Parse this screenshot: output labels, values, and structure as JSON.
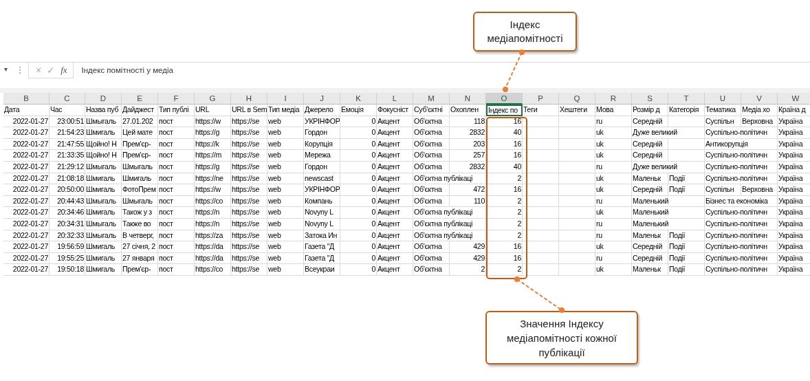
{
  "formula_bar": {
    "name_box_caret": "▾",
    "cancel": "×",
    "enter": "✓",
    "function": "fx",
    "formula": "Індекс помітності у медіа"
  },
  "columns": [
    {
      "letter": "B",
      "selected": false
    },
    {
      "letter": "C",
      "selected": false
    },
    {
      "letter": "D",
      "selected": false
    },
    {
      "letter": "E",
      "selected": false
    },
    {
      "letter": "F",
      "selected": false
    },
    {
      "letter": "G",
      "selected": false
    },
    {
      "letter": "H",
      "selected": false
    },
    {
      "letter": "I",
      "selected": false
    },
    {
      "letter": "J",
      "selected": false
    },
    {
      "letter": "K",
      "selected": false
    },
    {
      "letter": "L",
      "selected": false
    },
    {
      "letter": "M",
      "selected": false
    },
    {
      "letter": "N",
      "selected": false
    },
    {
      "letter": "O",
      "selected": true
    },
    {
      "letter": "P",
      "selected": false
    },
    {
      "letter": "Q",
      "selected": false
    },
    {
      "letter": "R",
      "selected": false
    },
    {
      "letter": "S",
      "selected": false
    },
    {
      "letter": "T",
      "selected": false
    },
    {
      "letter": "U",
      "selected": false
    },
    {
      "letter": "V",
      "selected": false
    },
    {
      "letter": "W",
      "selected": false
    }
  ],
  "header_row": [
    "Дата",
    "Час",
    "Назва пуб",
    "Дайджест",
    "Тип публі",
    "URL",
    "URL в Sem",
    "Тип медіа",
    "Джерело",
    "Емоція",
    "Фокусніст",
    "Суб'єктні",
    "Охоплен",
    "Індекс по",
    "Теги",
    "Хештеги",
    "Мова",
    "Розмір д",
    "Категорія",
    "Тематика",
    "Медіа хо",
    "Країна д"
  ],
  "rows": [
    {
      "cells": [
        {
          "kind": "number",
          "text": "2022-01-27"
        },
        {
          "kind": "number",
          "text": "23:00:51"
        },
        {
          "kind": "text",
          "text": "Шмыгаль"
        },
        {
          "kind": "text",
          "text": "27.01.202"
        },
        {
          "kind": "text",
          "text": "пост"
        },
        {
          "kind": "text",
          "text": "https://w"
        },
        {
          "kind": "text",
          "text": "https://se"
        },
        {
          "kind": "text",
          "text": "web"
        },
        {
          "kind": "text",
          "text": "УКРІНФОР"
        },
        {
          "kind": "number",
          "text": "0"
        },
        {
          "kind": "text",
          "text": "Акцент"
        },
        {
          "kind": "text",
          "text": "Об'єктна"
        },
        {
          "kind": "number",
          "text": "118"
        },
        {
          "kind": "number",
          "text": "16"
        },
        {
          "kind": "blank"
        },
        {
          "kind": "blank"
        },
        {
          "kind": "text",
          "text": "ru"
        },
        {
          "kind": "text",
          "text": "Середній"
        },
        {
          "kind": "blank"
        },
        {
          "kind": "text",
          "text": "Суспільн"
        },
        {
          "kind": "text",
          "text": "Верховна"
        },
        {
          "kind": "text",
          "text": "Україна"
        }
      ]
    },
    {
      "cells": [
        {
          "kind": "number",
          "text": "2022-01-27"
        },
        {
          "kind": "number",
          "text": "21:54:23"
        },
        {
          "kind": "text",
          "text": "Шмигаль"
        },
        {
          "kind": "text",
          "text": "Цей мате"
        },
        {
          "kind": "text",
          "text": "пост"
        },
        {
          "kind": "text",
          "text": "https://g"
        },
        {
          "kind": "text",
          "text": "https://se"
        },
        {
          "kind": "text",
          "text": "web"
        },
        {
          "kind": "text",
          "text": "Гордон"
        },
        {
          "kind": "number",
          "text": "0"
        },
        {
          "kind": "text",
          "text": "Акцент"
        },
        {
          "kind": "text",
          "text": "Об'єктна"
        },
        {
          "kind": "number",
          "text": "2832"
        },
        {
          "kind": "number",
          "text": "40"
        },
        {
          "kind": "blank"
        },
        {
          "kind": "blank"
        },
        {
          "kind": "text",
          "text": "uk"
        },
        {
          "kind": "text",
          "text": "Дуже великий"
        },
        {
          "kind": "blank"
        },
        {
          "kind": "text",
          "text": "Суспільно-політичн"
        },
        {
          "kind": "blank"
        },
        {
          "kind": "text",
          "text": "Україна"
        }
      ]
    },
    {
      "cells": [
        {
          "kind": "number",
          "text": "2022-01-27"
        },
        {
          "kind": "number",
          "text": "21:47:55"
        },
        {
          "kind": "text",
          "text": "Щойно! Н"
        },
        {
          "kind": "text",
          "text": "Прем'єр-"
        },
        {
          "kind": "text",
          "text": "пост"
        },
        {
          "kind": "text",
          "text": "https://k"
        },
        {
          "kind": "text",
          "text": "https://se"
        },
        {
          "kind": "text",
          "text": "web"
        },
        {
          "kind": "text",
          "text": "Корупція"
        },
        {
          "kind": "number",
          "text": "0"
        },
        {
          "kind": "text",
          "text": "Акцент"
        },
        {
          "kind": "text",
          "text": "Об'єктна"
        },
        {
          "kind": "number",
          "text": "203"
        },
        {
          "kind": "number",
          "text": "16"
        },
        {
          "kind": "blank"
        },
        {
          "kind": "blank"
        },
        {
          "kind": "text",
          "text": "uk"
        },
        {
          "kind": "text",
          "text": "Середній"
        },
        {
          "kind": "blank"
        },
        {
          "kind": "text",
          "text": "Антикорупція"
        },
        {
          "kind": "blank"
        },
        {
          "kind": "text",
          "text": "Україна"
        }
      ]
    },
    {
      "cells": [
        {
          "kind": "number",
          "text": "2022-01-27"
        },
        {
          "kind": "number",
          "text": "21:33:35"
        },
        {
          "kind": "text",
          "text": "Щойно! Н"
        },
        {
          "kind": "text",
          "text": "Прем'єр-"
        },
        {
          "kind": "text",
          "text": "пост"
        },
        {
          "kind": "text",
          "text": "https://m"
        },
        {
          "kind": "text",
          "text": "https://se"
        },
        {
          "kind": "text",
          "text": "web"
        },
        {
          "kind": "text",
          "text": "Мережа"
        },
        {
          "kind": "number",
          "text": "0"
        },
        {
          "kind": "text",
          "text": "Акцент"
        },
        {
          "kind": "text",
          "text": "Об'єктна"
        },
        {
          "kind": "number",
          "text": "257"
        },
        {
          "kind": "number",
          "text": "16"
        },
        {
          "kind": "blank"
        },
        {
          "kind": "blank"
        },
        {
          "kind": "text",
          "text": "uk"
        },
        {
          "kind": "text",
          "text": "Середній"
        },
        {
          "kind": "blank"
        },
        {
          "kind": "text",
          "text": "Суспільно-політичн"
        },
        {
          "kind": "blank"
        },
        {
          "kind": "text",
          "text": "Україна"
        }
      ]
    },
    {
      "cells": [
        {
          "kind": "number",
          "text": "2022-01-27"
        },
        {
          "kind": "number",
          "text": "21:29:12"
        },
        {
          "kind": "text",
          "text": "Шмыгаль"
        },
        {
          "kind": "text",
          "text": "Шмыгаль"
        },
        {
          "kind": "text",
          "text": "пост"
        },
        {
          "kind": "text",
          "text": "https://g"
        },
        {
          "kind": "text",
          "text": "https://se"
        },
        {
          "kind": "text",
          "text": "web"
        },
        {
          "kind": "text",
          "text": "Гордон"
        },
        {
          "kind": "number",
          "text": "0"
        },
        {
          "kind": "text",
          "text": "Акцент"
        },
        {
          "kind": "text",
          "text": "Об'єктна"
        },
        {
          "kind": "number",
          "text": "2832"
        },
        {
          "kind": "number",
          "text": "40"
        },
        {
          "kind": "blank"
        },
        {
          "kind": "blank"
        },
        {
          "kind": "text",
          "text": "ru"
        },
        {
          "kind": "text",
          "text": "Дуже великий"
        },
        {
          "kind": "blank"
        },
        {
          "kind": "text",
          "text": "Суспільно-політичн"
        },
        {
          "kind": "blank"
        },
        {
          "kind": "text",
          "text": "Україна"
        }
      ]
    },
    {
      "cells": [
        {
          "kind": "number",
          "text": "2022-01-27"
        },
        {
          "kind": "number",
          "text": "21:08:18"
        },
        {
          "kind": "text",
          "text": "Шмигаль"
        },
        {
          "kind": "text",
          "text": "Шмигаль"
        },
        {
          "kind": "text",
          "text": "пост"
        },
        {
          "kind": "text",
          "text": "https://ne"
        },
        {
          "kind": "text",
          "text": "https://se"
        },
        {
          "kind": "text",
          "text": "web"
        },
        {
          "kind": "text",
          "text": "newscast"
        },
        {
          "kind": "number",
          "text": "0"
        },
        {
          "kind": "text",
          "text": "Акцент"
        },
        {
          "kind": "text",
          "text": "Об'єктна публікаці"
        },
        {
          "kind": "blank"
        },
        {
          "kind": "number",
          "text": "2"
        },
        {
          "kind": "blank"
        },
        {
          "kind": "blank"
        },
        {
          "kind": "text",
          "text": "uk"
        },
        {
          "kind": "text",
          "text": "Маленьк"
        },
        {
          "kind": "text",
          "text": "Події"
        },
        {
          "kind": "text",
          "text": "Суспільно-політичн"
        },
        {
          "kind": "blank"
        },
        {
          "kind": "text",
          "text": "Україна"
        }
      ]
    },
    {
      "cells": [
        {
          "kind": "number",
          "text": "2022-01-27"
        },
        {
          "kind": "number",
          "text": "20:50:00"
        },
        {
          "kind": "text",
          "text": "Шмигаль"
        },
        {
          "kind": "text",
          "text": "ФотоПрем"
        },
        {
          "kind": "text",
          "text": "пост"
        },
        {
          "kind": "text",
          "text": "https://w"
        },
        {
          "kind": "text",
          "text": "https://se"
        },
        {
          "kind": "text",
          "text": "web"
        },
        {
          "kind": "text",
          "text": "УКРІНФОР"
        },
        {
          "kind": "number",
          "text": "0"
        },
        {
          "kind": "text",
          "text": "Акцент"
        },
        {
          "kind": "text",
          "text": "Об'єктна"
        },
        {
          "kind": "number",
          "text": "472"
        },
        {
          "kind": "number",
          "text": "16"
        },
        {
          "kind": "blank"
        },
        {
          "kind": "blank"
        },
        {
          "kind": "text",
          "text": "uk"
        },
        {
          "kind": "text",
          "text": "Середній"
        },
        {
          "kind": "text",
          "text": "Події"
        },
        {
          "kind": "text",
          "text": "Суспільн"
        },
        {
          "kind": "text",
          "text": "Верховна"
        },
        {
          "kind": "text",
          "text": "Україна"
        }
      ]
    },
    {
      "cells": [
        {
          "kind": "number",
          "text": "2022-01-27"
        },
        {
          "kind": "number",
          "text": "20:44:43"
        },
        {
          "kind": "text",
          "text": "Шмыгаль"
        },
        {
          "kind": "text",
          "text": "Шмыгаль"
        },
        {
          "kind": "text",
          "text": "пост"
        },
        {
          "kind": "text",
          "text": "https://co"
        },
        {
          "kind": "text",
          "text": "https://se"
        },
        {
          "kind": "text",
          "text": "web"
        },
        {
          "kind": "text",
          "text": "Компань"
        },
        {
          "kind": "number",
          "text": "0"
        },
        {
          "kind": "text",
          "text": "Акцент"
        },
        {
          "kind": "text",
          "text": "Об'єктна"
        },
        {
          "kind": "number",
          "text": "110"
        },
        {
          "kind": "number",
          "text": "2"
        },
        {
          "kind": "blank"
        },
        {
          "kind": "blank"
        },
        {
          "kind": "text",
          "text": "ru"
        },
        {
          "kind": "text",
          "text": "Маленький"
        },
        {
          "kind": "blank"
        },
        {
          "kind": "text",
          "text": "Бізнес та економіка"
        },
        {
          "kind": "blank"
        },
        {
          "kind": "text",
          "text": "Україна"
        }
      ]
    },
    {
      "cells": [
        {
          "kind": "number",
          "text": "2022-01-27"
        },
        {
          "kind": "number",
          "text": "20:34:46"
        },
        {
          "kind": "text",
          "text": "Шмигаль"
        },
        {
          "kind": "text",
          "text": "Також у з"
        },
        {
          "kind": "text",
          "text": "пост"
        },
        {
          "kind": "text",
          "text": "https://n"
        },
        {
          "kind": "text",
          "text": "https://se"
        },
        {
          "kind": "text",
          "text": "web"
        },
        {
          "kind": "text",
          "text": "Novyny L"
        },
        {
          "kind": "number",
          "text": "0"
        },
        {
          "kind": "text",
          "text": "Акцент"
        },
        {
          "kind": "text",
          "text": "Об'єктна публікаці"
        },
        {
          "kind": "blank"
        },
        {
          "kind": "number",
          "text": "2"
        },
        {
          "kind": "blank"
        },
        {
          "kind": "blank"
        },
        {
          "kind": "text",
          "text": "uk"
        },
        {
          "kind": "text",
          "text": "Маленький"
        },
        {
          "kind": "blank"
        },
        {
          "kind": "text",
          "text": "Суспільно-політичн"
        },
        {
          "kind": "blank"
        },
        {
          "kind": "text",
          "text": "Україна"
        }
      ]
    },
    {
      "cells": [
        {
          "kind": "number",
          "text": "2022-01-27"
        },
        {
          "kind": "number",
          "text": "20:34:31"
        },
        {
          "kind": "text",
          "text": "Шмыгаль"
        },
        {
          "kind": "text",
          "text": "Также во"
        },
        {
          "kind": "text",
          "text": "пост"
        },
        {
          "kind": "text",
          "text": "https://n"
        },
        {
          "kind": "text",
          "text": "https://se"
        },
        {
          "kind": "text",
          "text": "web"
        },
        {
          "kind": "text",
          "text": "Novyny L"
        },
        {
          "kind": "number",
          "text": "0"
        },
        {
          "kind": "text",
          "text": "Акцент"
        },
        {
          "kind": "text",
          "text": "Об'єктна публікаці"
        },
        {
          "kind": "blank"
        },
        {
          "kind": "number",
          "text": "2"
        },
        {
          "kind": "blank"
        },
        {
          "kind": "blank"
        },
        {
          "kind": "text",
          "text": "ru"
        },
        {
          "kind": "text",
          "text": "Маленький"
        },
        {
          "kind": "blank"
        },
        {
          "kind": "text",
          "text": "Суспільно-політичн"
        },
        {
          "kind": "blank"
        },
        {
          "kind": "text",
          "text": "Україна"
        }
      ]
    },
    {
      "cells": [
        {
          "kind": "number",
          "text": "2022-01-27"
        },
        {
          "kind": "number",
          "text": "20:32:33"
        },
        {
          "kind": "text",
          "text": "Шмыгаль"
        },
        {
          "kind": "text",
          "text": "В четверг,"
        },
        {
          "kind": "text",
          "text": "пост"
        },
        {
          "kind": "text",
          "text": "https://za"
        },
        {
          "kind": "text",
          "text": "https://se"
        },
        {
          "kind": "text",
          "text": "web"
        },
        {
          "kind": "text",
          "text": "Затока Ин"
        },
        {
          "kind": "number",
          "text": "0"
        },
        {
          "kind": "text",
          "text": "Акцент"
        },
        {
          "kind": "text",
          "text": "Об'єктна публікаці"
        },
        {
          "kind": "blank"
        },
        {
          "kind": "number",
          "text": "2"
        },
        {
          "kind": "blank"
        },
        {
          "kind": "blank"
        },
        {
          "kind": "text",
          "text": "ru"
        },
        {
          "kind": "text",
          "text": "Маленьк"
        },
        {
          "kind": "text",
          "text": "Події"
        },
        {
          "kind": "text",
          "text": "Суспільно-політичн"
        },
        {
          "kind": "blank"
        },
        {
          "kind": "text",
          "text": "Україна"
        }
      ]
    },
    {
      "cells": [
        {
          "kind": "number",
          "text": "2022-01-27"
        },
        {
          "kind": "number",
          "text": "19:56:59"
        },
        {
          "kind": "text",
          "text": "Шмигаль"
        },
        {
          "kind": "text",
          "text": "27 січня, 2"
        },
        {
          "kind": "text",
          "text": "пост"
        },
        {
          "kind": "text",
          "text": "https://da"
        },
        {
          "kind": "text",
          "text": "https://se"
        },
        {
          "kind": "text",
          "text": "web"
        },
        {
          "kind": "text",
          "text": "Газета \"Д"
        },
        {
          "kind": "number",
          "text": "0"
        },
        {
          "kind": "text",
          "text": "Акцент"
        },
        {
          "kind": "text",
          "text": "Об'єктна"
        },
        {
          "kind": "number",
          "text": "429"
        },
        {
          "kind": "number",
          "text": "16"
        },
        {
          "kind": "blank"
        },
        {
          "kind": "blank"
        },
        {
          "kind": "text",
          "text": "uk"
        },
        {
          "kind": "text",
          "text": "Середній"
        },
        {
          "kind": "text",
          "text": "Події"
        },
        {
          "kind": "text",
          "text": "Суспільно-політичн"
        },
        {
          "kind": "blank"
        },
        {
          "kind": "text",
          "text": "Україна"
        }
      ]
    },
    {
      "cells": [
        {
          "kind": "number",
          "text": "2022-01-27"
        },
        {
          "kind": "number",
          "text": "19:55:25"
        },
        {
          "kind": "text",
          "text": "Шмигаль"
        },
        {
          "kind": "text",
          "text": "27 января"
        },
        {
          "kind": "text",
          "text": "пост"
        },
        {
          "kind": "text",
          "text": "https://da"
        },
        {
          "kind": "text",
          "text": "https://se"
        },
        {
          "kind": "text",
          "text": "web"
        },
        {
          "kind": "text",
          "text": "Газета \"Д"
        },
        {
          "kind": "number",
          "text": "0"
        },
        {
          "kind": "text",
          "text": "Акцент"
        },
        {
          "kind": "text",
          "text": "Об'єктна"
        },
        {
          "kind": "number",
          "text": "429"
        },
        {
          "kind": "number",
          "text": "16"
        },
        {
          "kind": "blank"
        },
        {
          "kind": "blank"
        },
        {
          "kind": "text",
          "text": "ru"
        },
        {
          "kind": "text",
          "text": "Середній"
        },
        {
          "kind": "text",
          "text": "Події"
        },
        {
          "kind": "text",
          "text": "Суспільно-політичн"
        },
        {
          "kind": "blank"
        },
        {
          "kind": "text",
          "text": "Україна"
        }
      ]
    },
    {
      "cells": [
        {
          "kind": "number",
          "text": "2022-01-27"
        },
        {
          "kind": "number",
          "text": "19:50:18"
        },
        {
          "kind": "text",
          "text": "Шмигаль"
        },
        {
          "kind": "text",
          "text": "Прем'єр-"
        },
        {
          "kind": "text",
          "text": "пост"
        },
        {
          "kind": "text",
          "text": "https://co"
        },
        {
          "kind": "text",
          "text": "https://se"
        },
        {
          "kind": "text",
          "text": "web"
        },
        {
          "kind": "text",
          "text": "Всеукраи"
        },
        {
          "kind": "number",
          "text": "0"
        },
        {
          "kind": "text",
          "text": "Акцент"
        },
        {
          "kind": "text",
          "text": "Об'єктна"
        },
        {
          "kind": "number",
          "text": "2"
        },
        {
          "kind": "number",
          "text": "2"
        },
        {
          "kind": "blank"
        },
        {
          "kind": "blank"
        },
        {
          "kind": "text",
          "text": "uk"
        },
        {
          "kind": "text",
          "text": "Маленьк"
        },
        {
          "kind": "text",
          "text": "Події"
        },
        {
          "kind": "text",
          "text": "Суспільно-політичн"
        },
        {
          "kind": "blank"
        },
        {
          "kind": "text",
          "text": "Україна"
        }
      ]
    }
  ],
  "callouts": [
    {
      "text": "Індекс медіапомітності"
    },
    {
      "text": "Значення Індексу медіапомітності кожної публікації"
    }
  ]
}
